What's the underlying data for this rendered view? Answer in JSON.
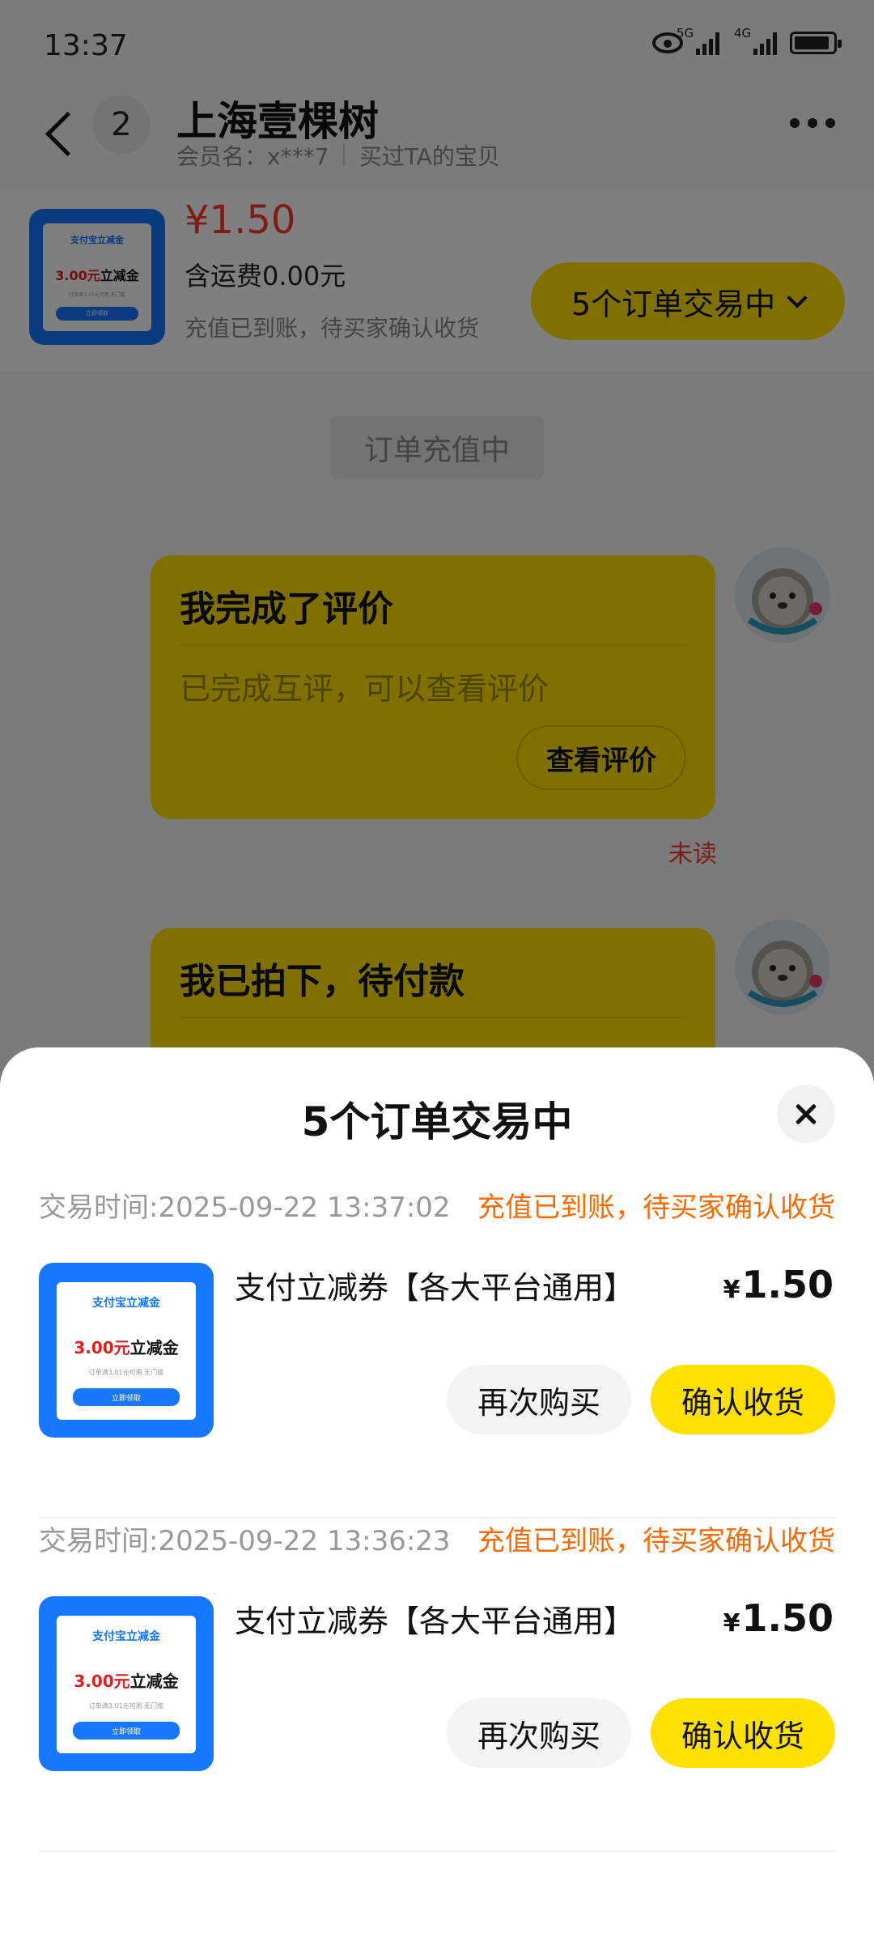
{
  "status_bar": {
    "time": "13:37",
    "icons": [
      "eye-icon",
      "signal-5g-icon",
      "signal-4g-icon",
      "battery-icon"
    ],
    "net1": "5G",
    "net2": "4G"
  },
  "header": {
    "unread_count": "2",
    "shop_name": "上海壹棵树",
    "member_label": "会员名：x***7",
    "bought_label": "买过TA的宝贝"
  },
  "order_bar": {
    "price": "¥1.50",
    "shipping": "含运费0.00元",
    "status": "充值已到账，待买家确认收货",
    "orders_button": "5个订单交易中"
  },
  "chat": {
    "system_pill": "订单充值中",
    "card1": {
      "title": "我完成了评价",
      "body": "已完成互评，可以查看评价",
      "button": "查看评价"
    },
    "unread_label": "未读",
    "card2": {
      "title": "我已拍下，待付款"
    }
  },
  "coupon_art": {
    "header": "支付宝立减金",
    "amount_red": "3.00元",
    "amount_black": "立减金",
    "fine_print": "订单满3.01元可用 无门槛",
    "get_button": "立即领取"
  },
  "sheet": {
    "title": "5个订单交易中",
    "orders": [
      {
        "time": "交易时间:2025-09-22 13:37:02",
        "status": "充值已到账，待买家确认收货",
        "name": "支付立减券【各大平台通用】",
        "yen": "¥",
        "price": "1.50",
        "rebuy": "再次购买",
        "confirm": "确认收货"
      },
      {
        "time": "交易时间:2025-09-22 13:36:23",
        "status": "充值已到账，待买家确认收货",
        "name": "支付立减券【各大平台通用】",
        "yen": "¥",
        "price": "1.50",
        "rebuy": "再次购买",
        "confirm": "确认收货"
      }
    ]
  },
  "colors": {
    "brand_yellow": "#ffe100",
    "price_red": "#ff3b30",
    "status_orange": "#ff6a00",
    "coupon_blue": "#1677ff"
  }
}
